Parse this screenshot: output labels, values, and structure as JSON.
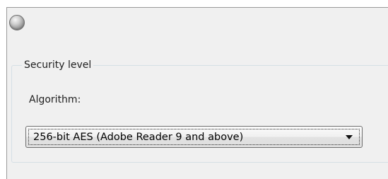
{
  "radio_option": {
    "state": "unselected",
    "icon": "radio-button-icon"
  },
  "security_group": {
    "legend": "Security level",
    "algorithm": {
      "label": "Algorithm:",
      "selected_value": "256-bit AES (Adobe Reader 9 and above)",
      "dropdown_icon": "chevron-down-icon"
    }
  }
}
